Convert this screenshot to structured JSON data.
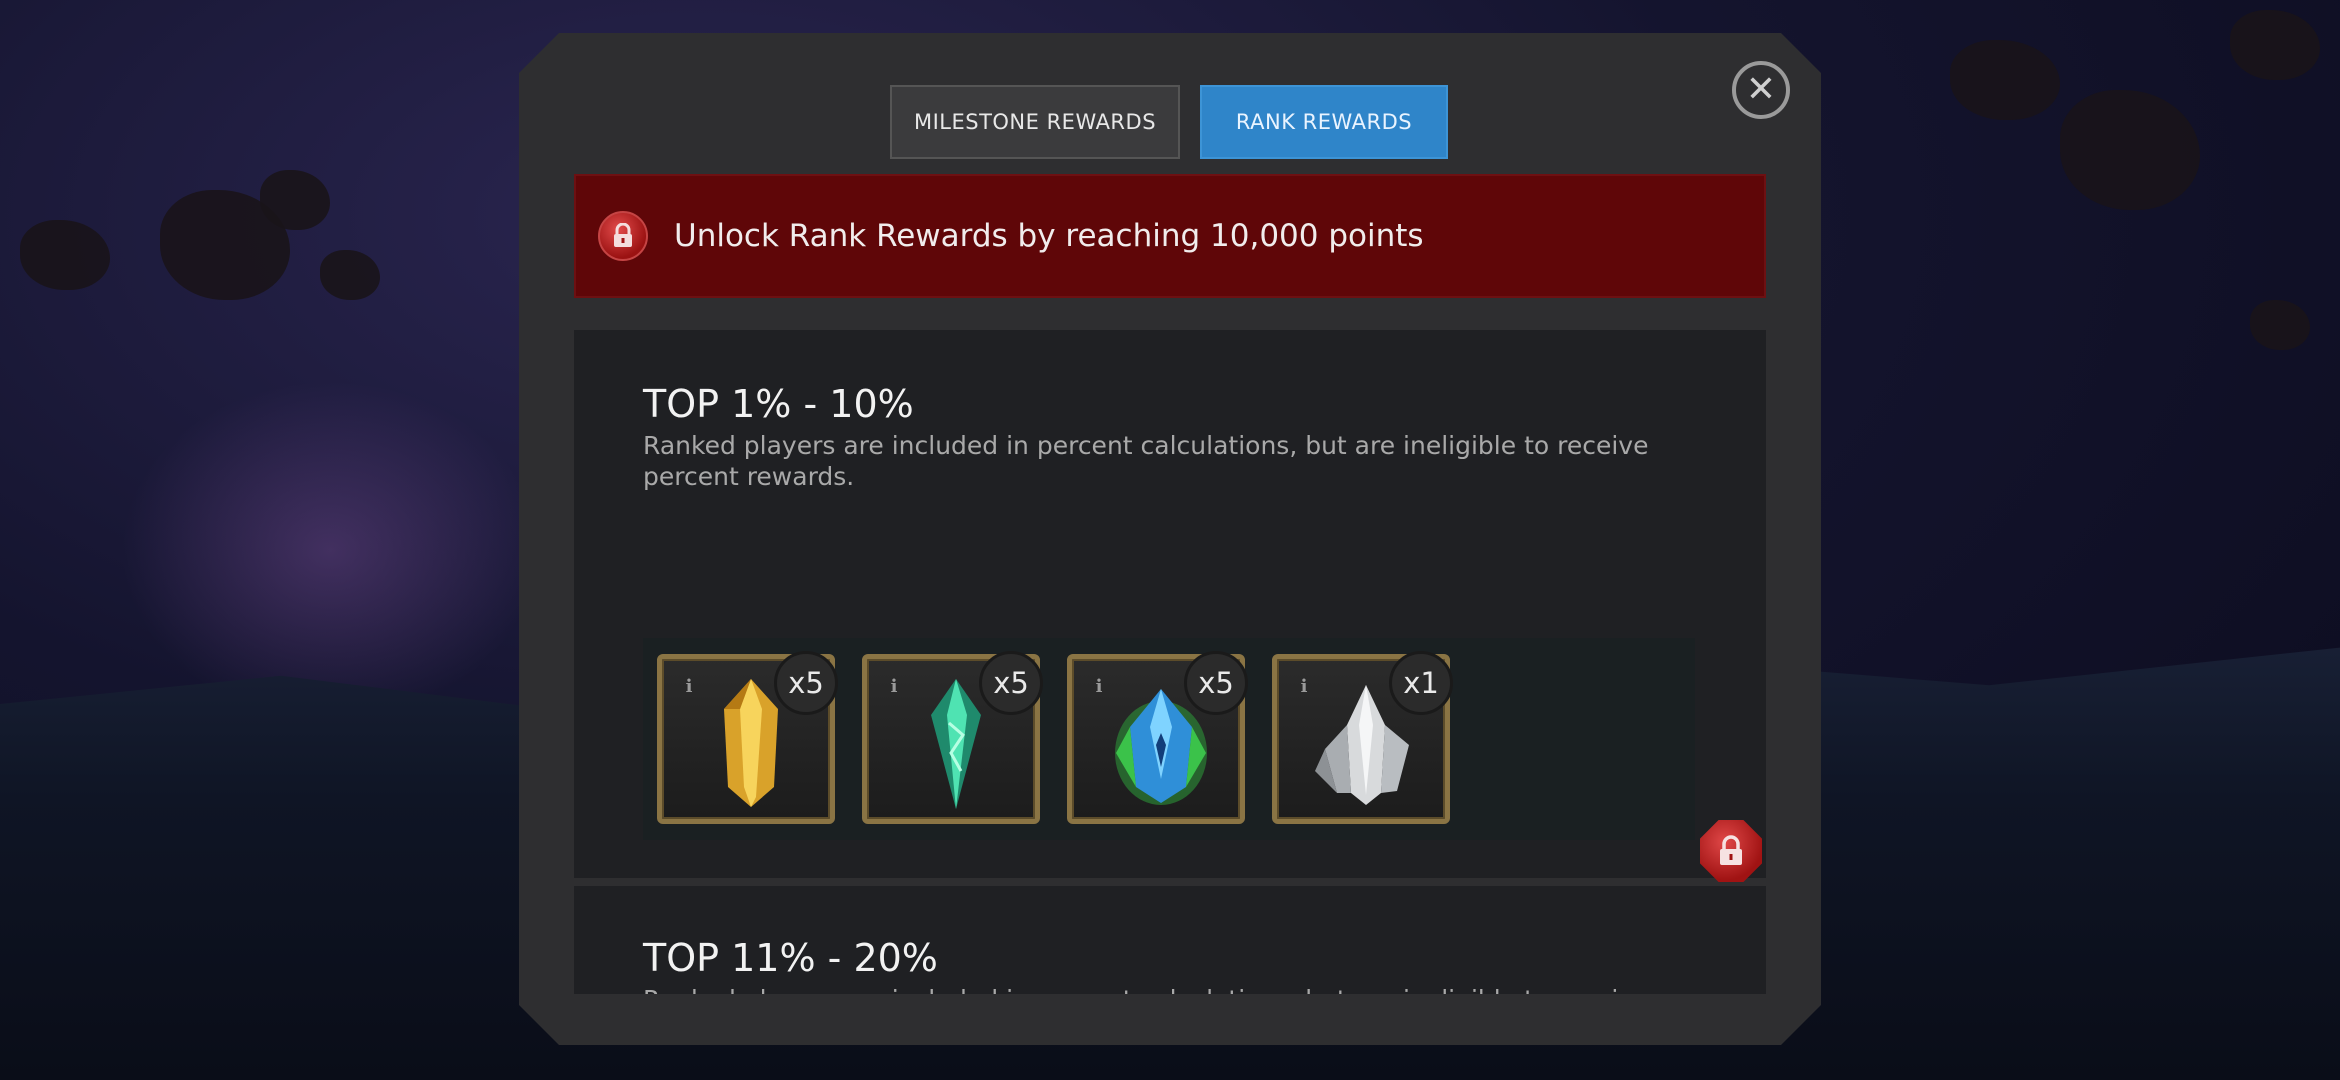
{
  "tabs": {
    "milestone_label": "MILESTONE REWARDS",
    "rank_label": "RANK REWARDS",
    "active": "rank"
  },
  "banner": {
    "text": "Unlock Rank Rewards by reaching 10,000 points"
  },
  "tiers": [
    {
      "title": "TOP 1% - 10%",
      "description": "Ranked players are included in percent calculations, but are ineligible to receive percent rewards.",
      "rewards": [
        {
          "icon": "gold-crystal-shard-icon",
          "quantity": "x5"
        },
        {
          "icon": "green-crystal-shard-icon",
          "quantity": "x5"
        },
        {
          "icon": "blue-green-crystal-icon",
          "quantity": "x5"
        },
        {
          "icon": "silver-crystal-icon",
          "quantity": "x1"
        }
      ]
    },
    {
      "title": "TOP 11% - 20%",
      "description": "Ranked players are included in percent calculations, but are ineligible to receive"
    }
  ],
  "colors": {
    "active_tab": "#2f85c9",
    "lock_banner": "#5f0608",
    "panel": "#2e2e30",
    "reward_frame": "#8a7444"
  }
}
